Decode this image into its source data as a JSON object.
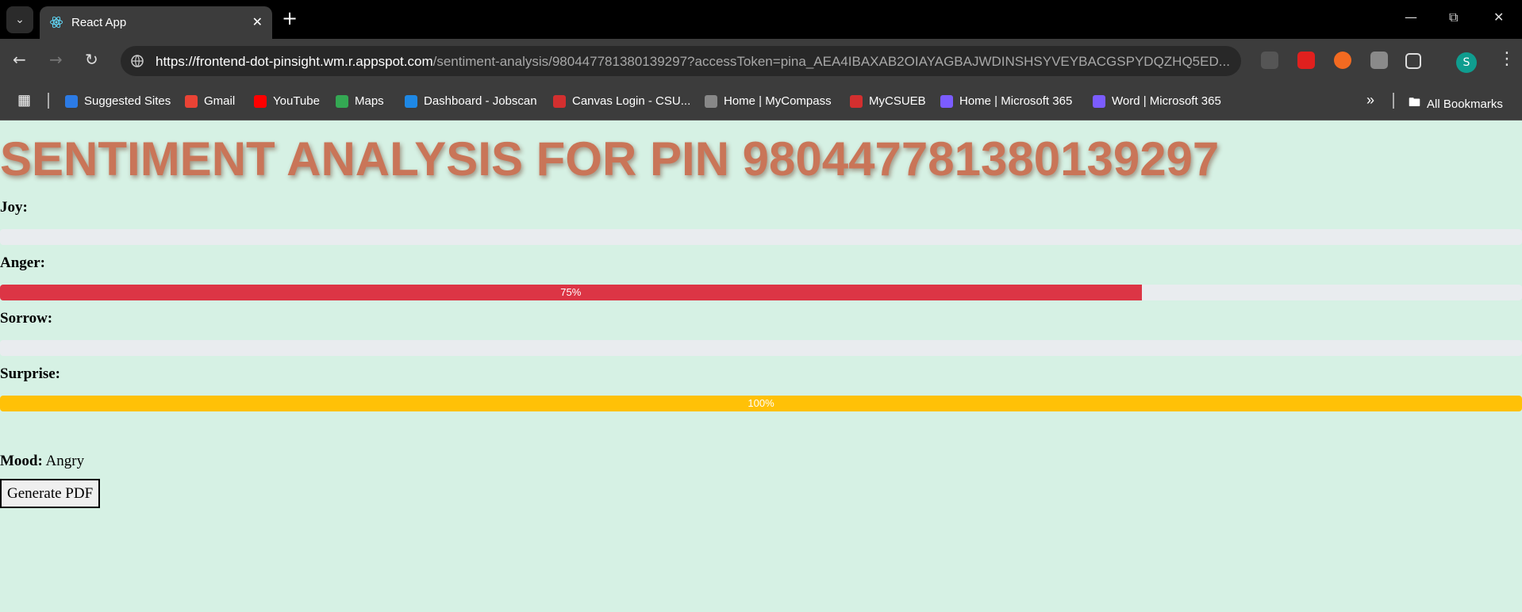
{
  "browser": {
    "tab_title": "React App",
    "url_host": "https://frontend-dot-pinsight.wm.r.appspot.com",
    "url_path": "/sentiment-analysis/980447781380139297?accessToken=pina_AEA4IBAXAB2OIAYAGBAJWDINSHSYVEYBACGSPYDQZHQ5ED...",
    "profile_initial": "S",
    "bookmarks": [
      {
        "label": "Suggested Sites",
        "icon": "edge-icon",
        "color": "#2c7be5"
      },
      {
        "label": "Gmail",
        "icon": "gmail-icon",
        "color": "#ea4335"
      },
      {
        "label": "YouTube",
        "icon": "youtube-icon",
        "color": "#ff0000"
      },
      {
        "label": "Maps",
        "icon": "maps-icon",
        "color": "#34a853"
      },
      {
        "label": "Dashboard - Jobscan",
        "icon": "jobscan-icon",
        "color": "#1e88e5"
      },
      {
        "label": "Canvas Login - CSU...",
        "icon": "eb-icon",
        "color": "#d32f2f"
      },
      {
        "label": "Home | MyCompass",
        "icon": "mycompass-icon",
        "color": "#888888"
      },
      {
        "label": "MyCSUEB",
        "icon": "eb-icon",
        "color": "#d32f2f"
      },
      {
        "label": "Home | Microsoft 365",
        "icon": "m365-icon",
        "color": "#7b5cff"
      },
      {
        "label": "Word | Microsoft 365",
        "icon": "m365-icon",
        "color": "#7b5cff"
      }
    ],
    "all_bookmarks_label": "All Bookmarks"
  },
  "page": {
    "heading": "SENTIMENT ANALYSIS FOR PIN 980447781380139297",
    "emotions": [
      {
        "label": "Joy:",
        "value": 0,
        "text": "",
        "color": "#28a745"
      },
      {
        "label": "Anger:",
        "value": 75,
        "text": "75%",
        "color": "#dc3545"
      },
      {
        "label": "Sorrow:",
        "value": 0,
        "text": "",
        "color": "#17a2b8"
      },
      {
        "label": "Surprise:",
        "value": 100,
        "text": "100%",
        "color": "#ffc107"
      }
    ],
    "mood_label": "Mood:",
    "mood_value": "Angry",
    "pdf_button": "Generate PDF"
  }
}
